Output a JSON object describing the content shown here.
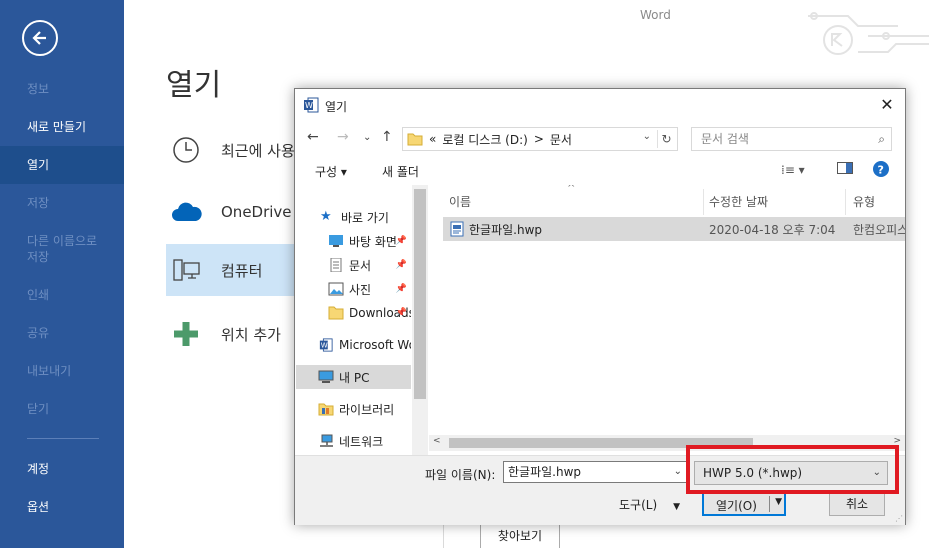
{
  "app": {
    "title": "Word"
  },
  "backstage": {
    "title": "열기",
    "nav": [
      {
        "label": "정보",
        "state": "disabled"
      },
      {
        "label": "새로 만들기",
        "state": "normal"
      },
      {
        "label": "열기",
        "state": "active"
      },
      {
        "label": "저장",
        "state": "disabled"
      },
      {
        "label": "다른 이름으로 저장",
        "state": "disabled"
      },
      {
        "label": "인쇄",
        "state": "disabled"
      },
      {
        "label": "공유",
        "state": "disabled"
      },
      {
        "label": "내보내기",
        "state": "disabled"
      },
      {
        "label": "닫기",
        "state": "disabled"
      },
      {
        "label": "계정",
        "state": "normal"
      },
      {
        "label": "옵션",
        "state": "normal"
      }
    ],
    "places": [
      {
        "label": "최근에 사용",
        "icon": "clock-icon"
      },
      {
        "label": "OneDrive -",
        "icon": "cloud-icon"
      },
      {
        "label": "컴퓨터",
        "icon": "computer-icon",
        "selected": true
      },
      {
        "label": "위치 추가",
        "icon": "plus-icon"
      }
    ],
    "browse_label": "찾아보기"
  },
  "dialog": {
    "title": "열기",
    "address": {
      "prefix": "«",
      "segments": [
        "로컬 디스크 (D:)",
        ">",
        "문서"
      ]
    },
    "search_placeholder": "문서 검색",
    "toolbar": {
      "organize": "구성 ▾",
      "new_folder": "새 폴더"
    },
    "nav_items": [
      {
        "label": "바로 가기",
        "icon": "star-icon",
        "indent": 1
      },
      {
        "label": "바탕 화면",
        "icon": "desktop-folder-icon",
        "indent": 2,
        "pinned": true
      },
      {
        "label": "문서",
        "icon": "documents-folder-icon",
        "indent": 2,
        "pinned": true
      },
      {
        "label": "사진",
        "icon": "pictures-folder-icon",
        "indent": 2,
        "pinned": true
      },
      {
        "label": "Downloads",
        "icon": "folder-icon",
        "indent": 2,
        "pinned": true
      },
      {
        "label": "Microsoft Word",
        "icon": "word-icon",
        "indent": 1
      },
      {
        "label": "내 PC",
        "icon": "pc-icon",
        "indent": 1,
        "selected": true
      },
      {
        "label": "라이브러리",
        "icon": "library-icon",
        "indent": 1
      },
      {
        "label": "네트워크",
        "icon": "network-icon",
        "indent": 1
      }
    ],
    "columns": {
      "name": "이름",
      "date": "수정한 날짜",
      "type": "유형"
    },
    "files": [
      {
        "name": "한글파일.hwp",
        "date": "2020-04-18 오후 7:04",
        "type": "한컴오피스"
      }
    ],
    "filename_label": "파일 이름(N):",
    "filename_value": "한글파일.hwp",
    "filter_value": "HWP 5.0 (*.hwp)",
    "tools_label": "도구(L)",
    "open_label": "열기(O)",
    "cancel_label": "취소"
  },
  "colors": {
    "sidebar": "#2b579a",
    "highlight": "#e01a22",
    "accent": "#0078d7"
  }
}
